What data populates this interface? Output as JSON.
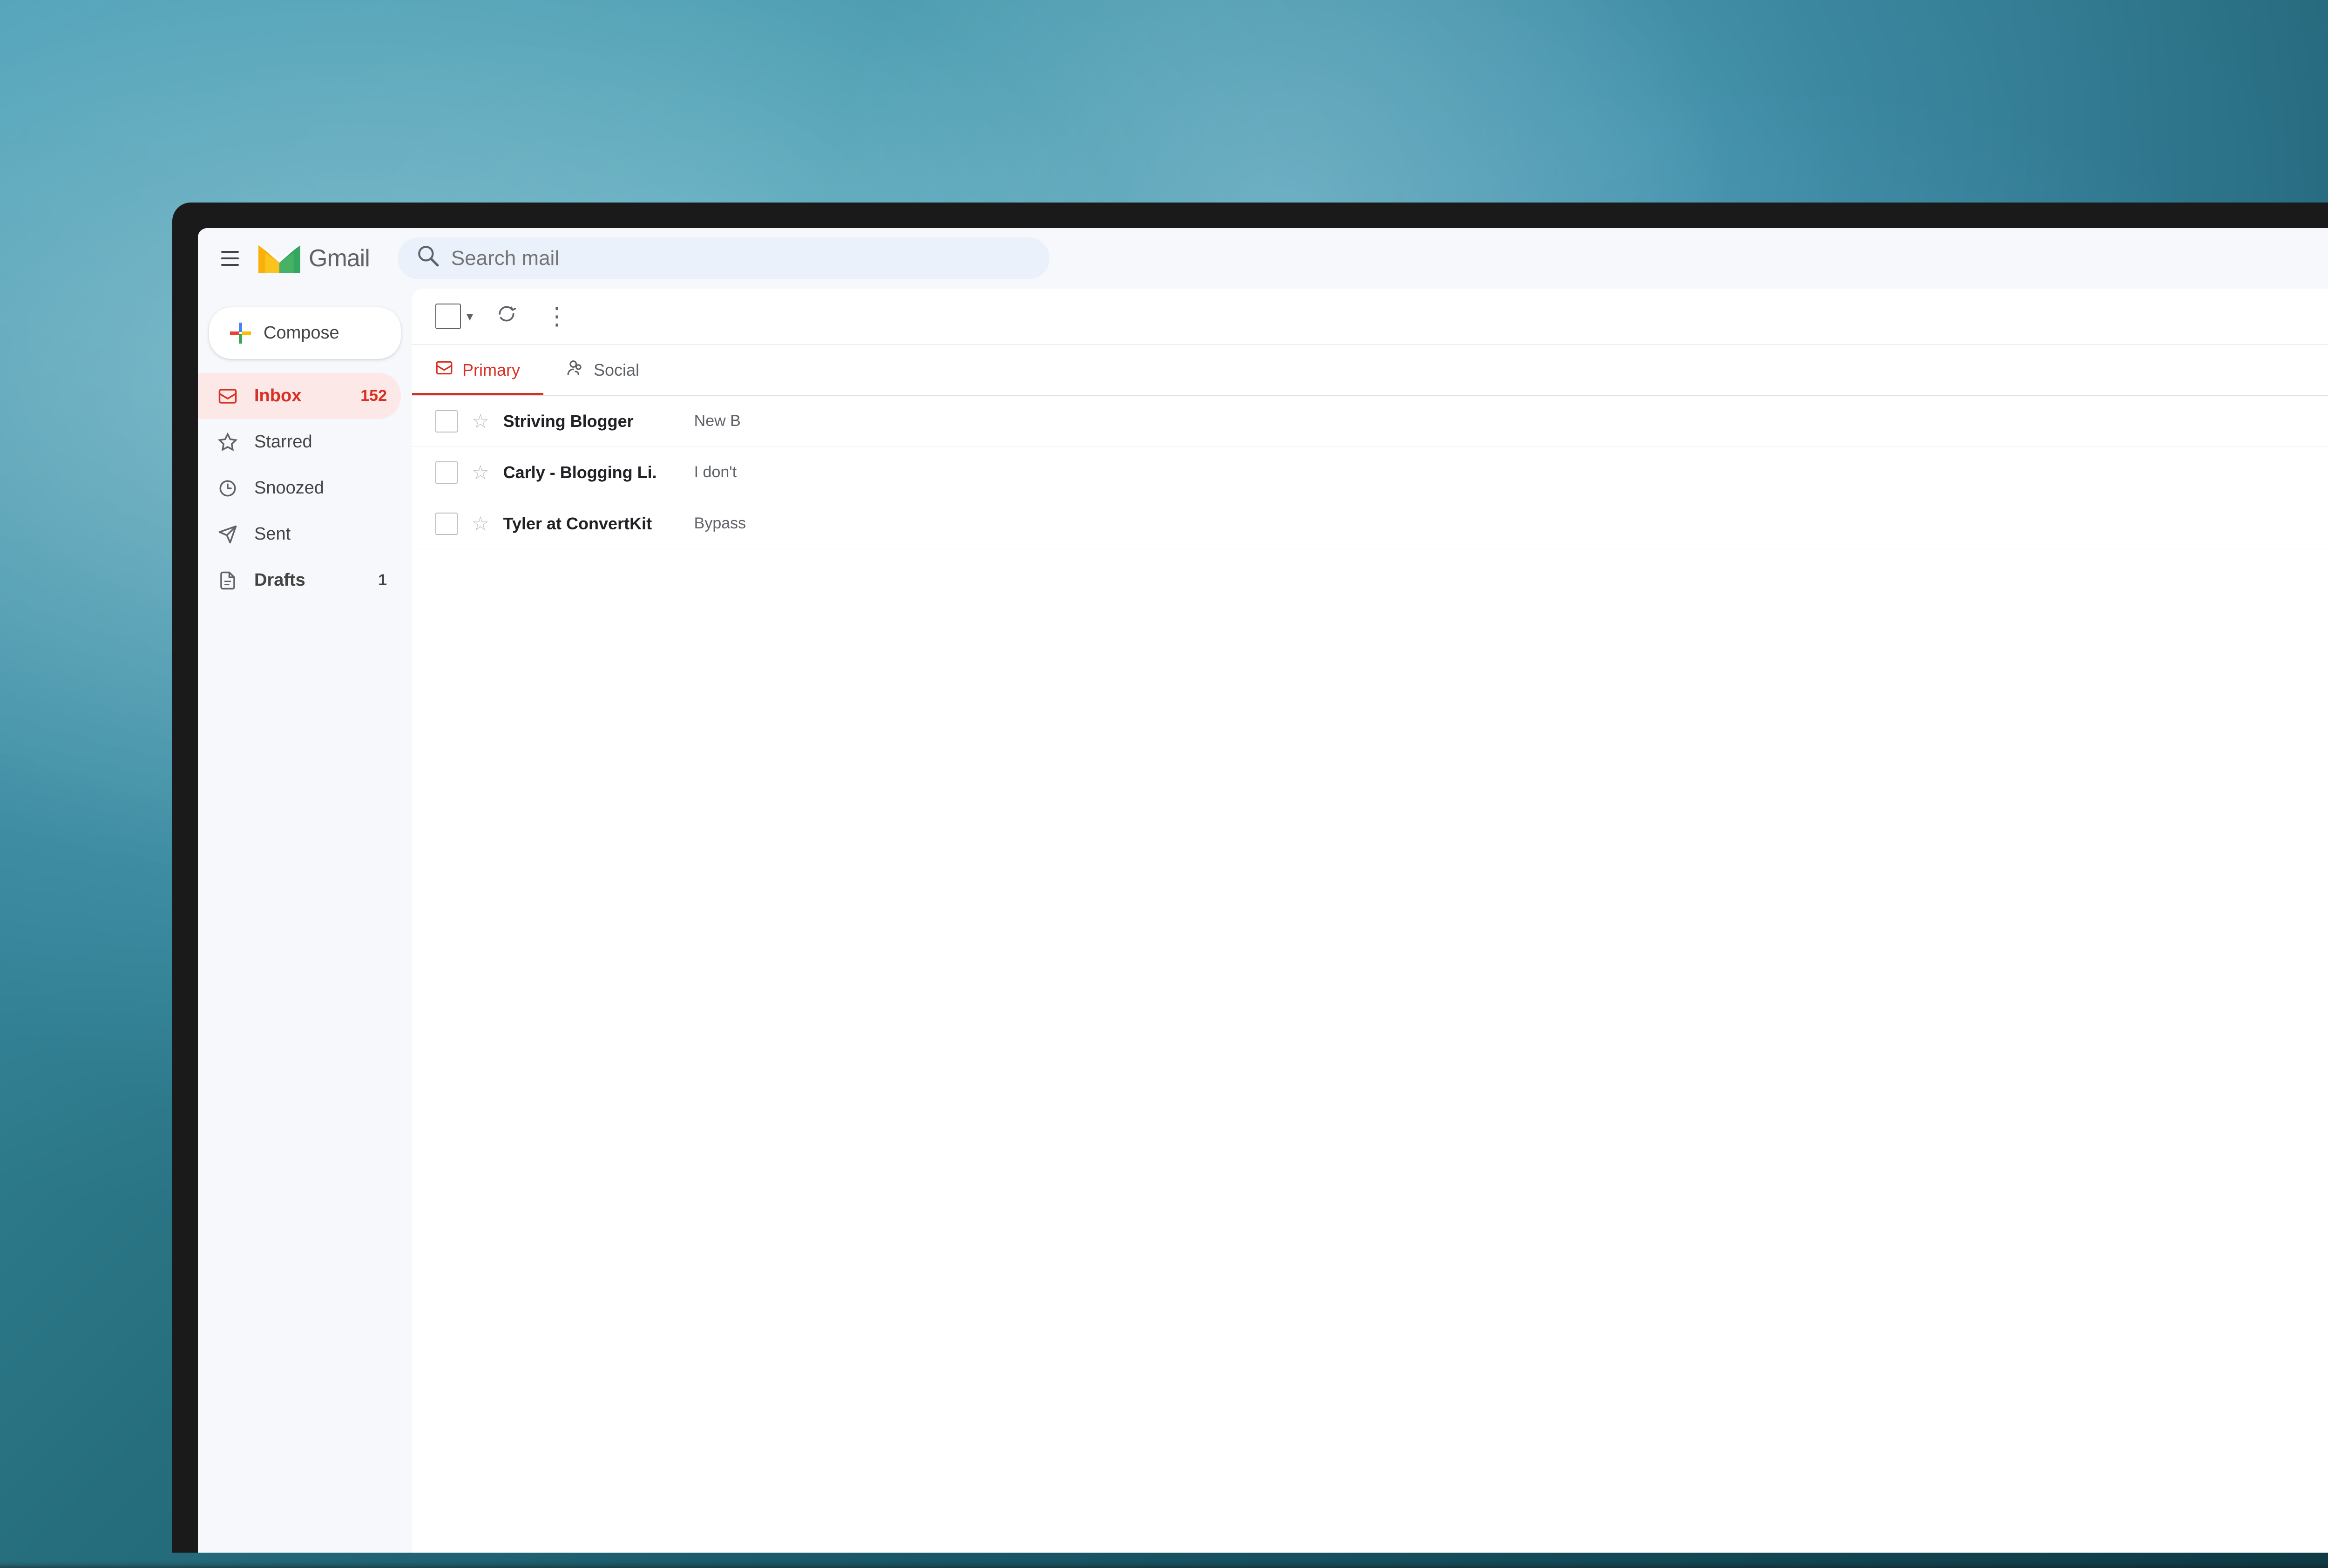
{
  "background": {
    "colors": [
      "#4a9db5",
      "#2d7a8a",
      "#1a5a6a"
    ]
  },
  "header": {
    "menu_icon_label": "Menu",
    "logo_text": "Gmail",
    "search_placeholder": "Search mail"
  },
  "sidebar": {
    "compose_label": "Compose",
    "nav_items": [
      {
        "id": "inbox",
        "label": "Inbox",
        "badge": "152",
        "icon": "inbox",
        "active": true
      },
      {
        "id": "starred",
        "label": "Starred",
        "badge": "",
        "icon": "star",
        "active": false
      },
      {
        "id": "snoozed",
        "label": "Snoozed",
        "badge": "",
        "icon": "clock",
        "active": false
      },
      {
        "id": "sent",
        "label": "Sent",
        "badge": "",
        "icon": "send",
        "active": false
      },
      {
        "id": "drafts",
        "label": "Drafts",
        "badge": "1",
        "icon": "draft",
        "active": false
      }
    ]
  },
  "toolbar": {
    "select_label": "Select",
    "refresh_label": "Refresh",
    "more_label": "More"
  },
  "tabs": [
    {
      "id": "primary",
      "label": "Primary",
      "active": true
    },
    {
      "id": "social",
      "label": "Social",
      "active": false
    }
  ],
  "emails": [
    {
      "sender": "Striving Blogger",
      "preview": "New B",
      "starred": false
    },
    {
      "sender": "Carly - Blogging Li.",
      "preview": "I don't",
      "starred": false
    },
    {
      "sender": "Tyler at ConvertKit",
      "preview": "Bypass",
      "starred": false
    }
  ]
}
